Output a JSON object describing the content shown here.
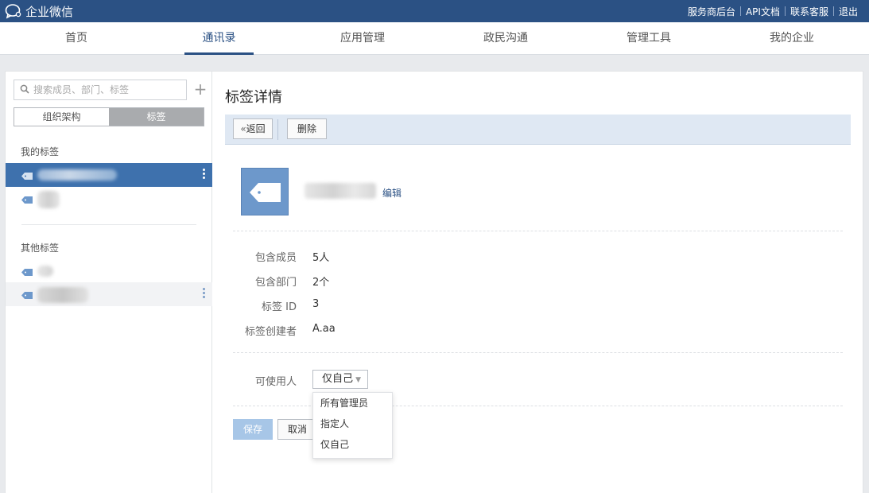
{
  "app": {
    "title": "企业微信"
  },
  "top_links": [
    "服务商后台",
    "API文档",
    "联系客服",
    "退出"
  ],
  "nav": {
    "items": [
      "首页",
      "通讯录",
      "应用管理",
      "政民沟通",
      "管理工具",
      "我的企业"
    ],
    "active": "通讯录"
  },
  "sidebar": {
    "search_placeholder": "搜索成员、部门、标签",
    "add_symbol": "+",
    "segments": [
      "组织架构",
      "标签"
    ],
    "active_segment": "标签",
    "my_tags_title": "我的标签",
    "other_tags_title": "其他标签"
  },
  "detail": {
    "title": "标签详情",
    "back_label": "返回",
    "back_icon": "double-chevron-left-icon",
    "delete_label": "删除",
    "edit_label": "编辑",
    "members_label": "包含成员",
    "members_value": "5人",
    "departments_label": "包含部门",
    "departments_value": "2个",
    "tag_id_label": "标签 ID",
    "tag_id_value": "3",
    "creator_label": "标签创建者",
    "creator_value": "A.aa",
    "usable_by_label": "可使用人",
    "usable_by_value": "仅自己",
    "usable_by_options": [
      "所有管理员",
      "指定人",
      "仅自己"
    ],
    "save_label": "保存",
    "cancel_label": "取消"
  },
  "colors": {
    "brand": "#2b5184",
    "selected_row": "#3e71ad",
    "toolbar": "#dfe8f3",
    "tag_icon": "#6d98cb"
  }
}
